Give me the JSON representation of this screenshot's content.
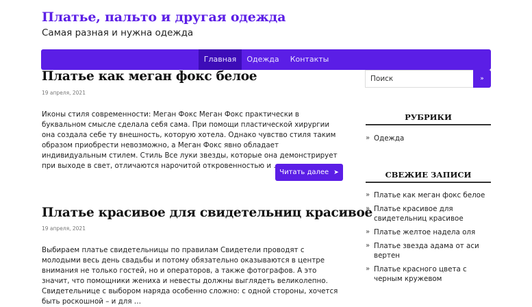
{
  "site": {
    "title": "Платье, пальто и другая одежда",
    "description": "Самая разная и нужна одежда"
  },
  "nav": {
    "items": [
      {
        "label": "Главная",
        "active": true
      },
      {
        "label": "Одежда",
        "active": false
      },
      {
        "label": "Контакты",
        "active": false
      }
    ]
  },
  "posts": [
    {
      "title": "Платье как меган фокс белое",
      "date": "19 апреля, 2021",
      "excerpt": " Иконы стиля современности: Меган Фокс Меган Фокс практически в буквальном смысле сделала себя сама. При помощи пластической хирургии она создала себе ту внешность, которую хотела. Однако чувство стиля таким образом приобрести невозможно, а Меган Фокс явно обладает индивидуальным стилем. Стиль Все луки звезды, которые она демонстрирует при выходе в свет, отличаются нарочитой откровенностью и …",
      "read_more": "Читать далее",
      "read_more_icon": "arrow-right-icon"
    },
    {
      "title": "Платье красивое для свидетельниц красивое",
      "date": "19 апреля, 2021",
      "excerpt": " Выбираем платье свидетельницы по правилам Свидетели проводят с молодыми весь день свадьбы и потому обязательно оказываются в центре внимания не только гостей, но и операторов, а также фотографов. А это значит, что помощники жениха и невесты должны выглядеть великолепно. Свидетельнице с выбором наряда особенно сложно: с одной стороны, хочется быть роскошной – и для …"
    }
  ],
  "sidebar": {
    "search": {
      "placeholder": "Поиск",
      "button_icon": "double-chevron-right-icon",
      "button_glyph": "»"
    },
    "categories": {
      "title": "РУБРИКИ",
      "items": [
        "Одежда"
      ]
    },
    "recent": {
      "title": "СВЕЖИЕ ЗАПИСИ",
      "items": [
        "Платье как меган фокс белое",
        "Платье красивое для свидетельниц красивое",
        "Платье желтое надела оля",
        "Платье звезда адама от аси вертен",
        "Платье красного цвета с черным кружевом"
      ]
    }
  },
  "colors": {
    "accent": "#5b1ee6",
    "accent_dark": "#3d0cb8",
    "text": "#222222",
    "muted": "#777777"
  }
}
